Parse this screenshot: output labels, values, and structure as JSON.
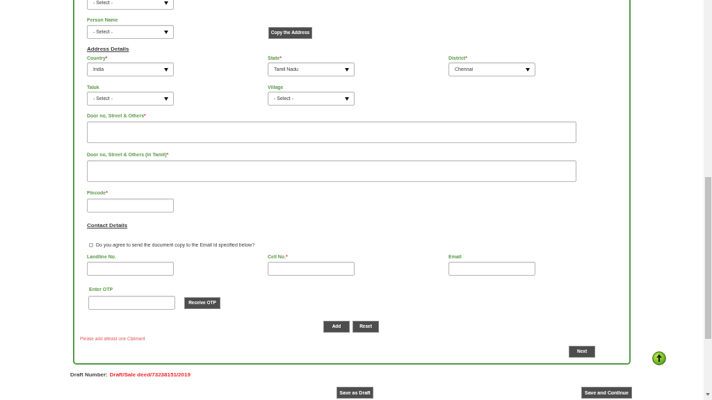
{
  "top_select": {
    "value": "- Select -"
  },
  "person_name": {
    "label": "Person Name",
    "value": "- Select -"
  },
  "copy_address_button": "Copy the Address",
  "address_details": {
    "heading": "Address Details",
    "selects": [
      {
        "label": "Country",
        "mark": "*",
        "value": "India"
      },
      {
        "label": "State",
        "mark": "*",
        "value": "Tamil Nadu"
      },
      {
        "label": "District",
        "mark": "*",
        "value": "Chennai"
      },
      {
        "label": "Taluk",
        "value": "- Select -"
      },
      {
        "label": "Village",
        "value": "- Select -"
      }
    ],
    "text_areas": [
      {
        "label": "Door no, Street & Others",
        "mark": "*"
      },
      {
        "label": "Door no, Street & Others (in Tamil)",
        "mark": "*"
      }
    ],
    "pincode": {
      "label": "Pincode",
      "mark": "*"
    }
  },
  "contact_details": {
    "heading": "Contact Details",
    "email_consent": {
      "label": "Do you agree to send the document copy to the Email id specified below?",
      "checked": false
    },
    "fields": [
      {
        "label": "Landline No."
      },
      {
        "label": "Cell No.",
        "mark": "*"
      },
      {
        "label": "Email"
      }
    ],
    "otp": {
      "label": "Enter OTP",
      "button": "Receive OTP"
    }
  },
  "form_buttons": [
    "Add",
    "Reset"
  ],
  "error_message": "Please add atleast one Claimant",
  "next_button": "Next",
  "draft_number": {
    "label": "Draft Number:",
    "value": "Draft/Sale deed/73238151/2019"
  },
  "page_buttons": [
    "Save as Draft",
    "Save and Continue"
  ]
}
